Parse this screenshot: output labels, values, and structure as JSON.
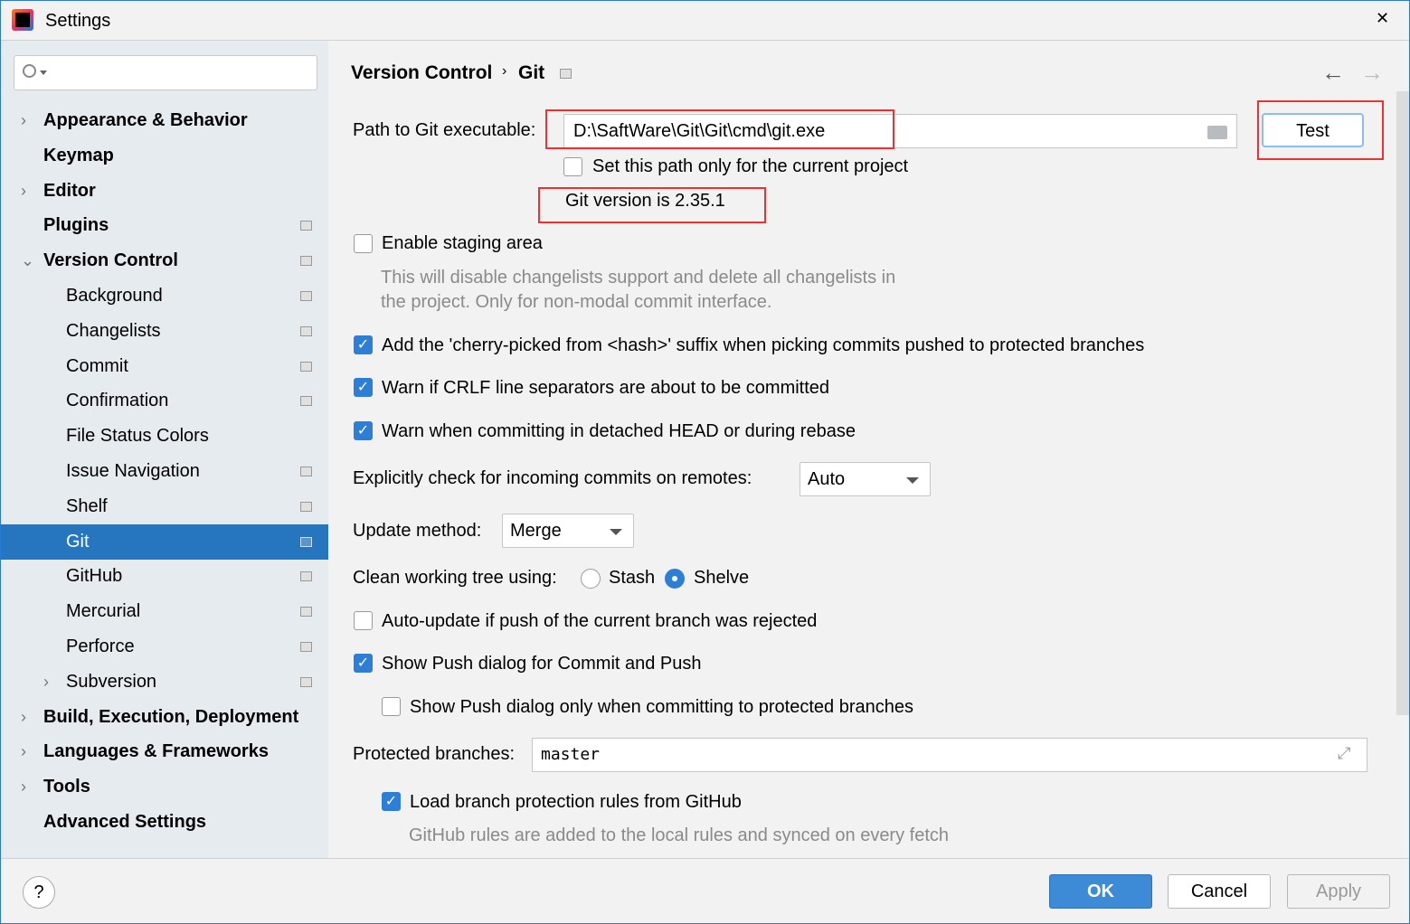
{
  "window": {
    "title": "Settings",
    "close": "✕"
  },
  "sidebar": {
    "search_placeholder": "",
    "items": [
      {
        "label": "Appearance & Behavior",
        "bold": true,
        "chevron": "›",
        "level": 0
      },
      {
        "label": "Keymap",
        "bold": true,
        "level": 0
      },
      {
        "label": "Editor",
        "bold": true,
        "chevron": "›",
        "level": 0
      },
      {
        "label": "Plugins",
        "bold": true,
        "level": 0,
        "page_icon": true
      },
      {
        "label": "Version Control",
        "bold": true,
        "chevron": "⌄",
        "level": 0,
        "page_icon": true
      },
      {
        "label": "Background",
        "level": 1,
        "page_icon": true
      },
      {
        "label": "Changelists",
        "level": 1,
        "page_icon": true
      },
      {
        "label": "Commit",
        "level": 1,
        "page_icon": true
      },
      {
        "label": "Confirmation",
        "level": 1,
        "page_icon": true
      },
      {
        "label": "File Status Colors",
        "level": 1
      },
      {
        "label": "Issue Navigation",
        "level": 1,
        "page_icon": true
      },
      {
        "label": "Shelf",
        "level": 1,
        "page_icon": true
      },
      {
        "label": "Git",
        "level": 1,
        "page_icon": true,
        "selected": true
      },
      {
        "label": "GitHub",
        "level": 1,
        "page_icon": true
      },
      {
        "label": "Mercurial",
        "level": 1,
        "page_icon": true
      },
      {
        "label": "Perforce",
        "level": 1,
        "page_icon": true
      },
      {
        "label": "Subversion",
        "level": 1,
        "chevron": "›",
        "page_icon": true
      },
      {
        "label": "Build, Execution, Deployment",
        "bold": true,
        "chevron": "›",
        "level": 0
      },
      {
        "label": "Languages & Frameworks",
        "bold": true,
        "chevron": "›",
        "level": 0
      },
      {
        "label": "Tools",
        "bold": true,
        "chevron": "›",
        "level": 0
      },
      {
        "label": "Advanced Settings",
        "bold": true,
        "level": 0
      }
    ]
  },
  "breadcrumb": {
    "parent": "Version Control",
    "sep": "›",
    "current": "Git"
  },
  "git": {
    "path_label": "Path to Git executable:",
    "path_value": "D:\\SaftWare\\Git\\Git\\cmd\\git.exe",
    "test_label": "Test",
    "current_project_only": {
      "label": "Set this path only for the current project",
      "checked": false
    },
    "version_text": "Git version is 2.35.1",
    "staging": {
      "label": "Enable staging area",
      "checked": false,
      "hint1": "This will disable changelists support and delete all changelists in",
      "hint2": "the project. Only for non-modal commit interface."
    },
    "cherry": {
      "label": "Add the 'cherry-picked from <hash>' suffix when picking commits pushed to protected branches",
      "checked": true
    },
    "crlf": {
      "label": "Warn if CRLF line separators are about to be committed",
      "checked": true
    },
    "detached": {
      "label": "Warn when committing in detached HEAD or during rebase",
      "checked": true
    },
    "incoming_label": "Explicitly check for incoming commits on remotes:",
    "incoming_value": "Auto",
    "update_label": "Update method:",
    "update_value": "Merge",
    "clean_label": "Clean working tree using:",
    "clean_options": [
      {
        "label": "Stash",
        "selected": false
      },
      {
        "label": "Shelve",
        "selected": true
      }
    ],
    "autoupdate": {
      "label": "Auto-update if push of the current branch was rejected",
      "checked": false
    },
    "showpush": {
      "label": "Show Push dialog for Commit and Push",
      "checked": true
    },
    "showpush_protected": {
      "label": "Show Push dialog only when committing to protected branches",
      "checked": false
    },
    "protected_label": "Protected branches:",
    "protected_value": "master",
    "github_rules": {
      "label": "Load branch protection rules from GitHub",
      "checked": true,
      "hint": "GitHub rules are added to the local rules and synced on every fetch"
    }
  },
  "footer": {
    "help": "?",
    "ok": "OK",
    "cancel": "Cancel",
    "apply": "Apply"
  },
  "colors": {
    "accent": "#2675bf",
    "highlight": "#f03030"
  }
}
